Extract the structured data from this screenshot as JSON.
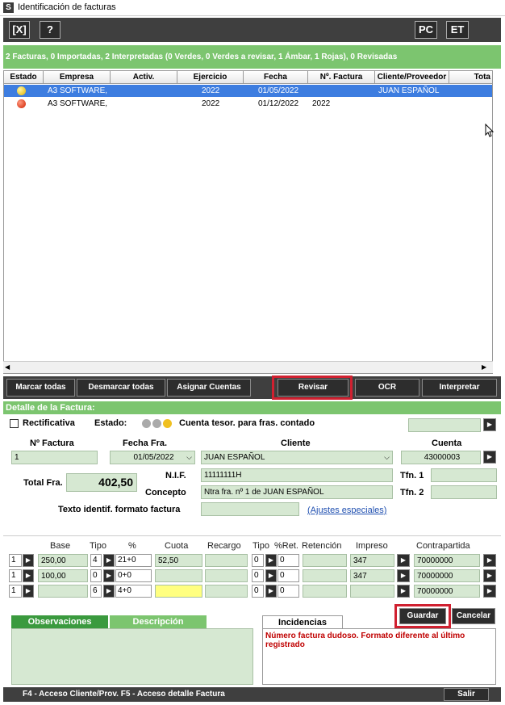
{
  "window": {
    "title": "Identificación de facturas",
    "app_icon": "S"
  },
  "toolbar": {
    "close_label": "[X]",
    "help_label": "?",
    "pc_label": "PC",
    "et_label": "ET"
  },
  "summary": "2 Facturas, 0 Importadas, 2 Interpretadas (0 Verdes, 0 Verdes a revisar, 1 Ámbar, 1 Rojas), 0 Revisadas",
  "grid": {
    "headers": [
      "Estado",
      "Empresa",
      "Activ.",
      "Ejercicio",
      "Fecha",
      "Nº. Factura",
      "Cliente/Proveedor",
      "Tota"
    ],
    "rows": [
      {
        "status": "amber",
        "empresa": "A3 SOFTWARE,",
        "ejercicio": "2022",
        "fecha": "01/05/2022",
        "factura": "",
        "cliente": "JUAN ESPAÑOL"
      },
      {
        "status": "red",
        "empresa": "A3 SOFTWARE,",
        "ejercicio": "2022",
        "fecha": "01/12/2022",
        "factura": "2022",
        "cliente": ""
      }
    ]
  },
  "actions": {
    "marcar": "Marcar todas",
    "desmarcar": "Desmarcar todas",
    "asignar": "Asignar Cuentas",
    "revisar": "Revisar",
    "ocr": "OCR",
    "interpretar": "Interpretar"
  },
  "detail": {
    "title": "Detalle de la Factura:",
    "rectificativa": "Rectificativa",
    "estado_label": "Estado:",
    "cuenta_tesor": "Cuenta tesor. para fras. contado",
    "nfactura_label": "Nº Factura",
    "nfactura": "1",
    "fecha_label": "Fecha Fra.",
    "fecha": "01/05/2022",
    "cliente_label": "Cliente",
    "cliente": "JUAN ESPAÑOL",
    "cuenta_label": "Cuenta",
    "cuenta": "43000003",
    "total_label": "Total Fra.",
    "total": "402,50",
    "nif_label": "N.I.F.",
    "nif": "11111111H",
    "tfn1_label": "Tfn. 1",
    "concepto_label": "Concepto",
    "concepto": "Ntra fra. nº 1 de JUAN ESPAÑOL",
    "tfn2_label": "Tfn. 2",
    "texto_label": "Texto identif. formato factura",
    "ajustes": "(Ajustes especiales)"
  },
  "lines": {
    "headers": [
      "Base",
      "Tipo",
      "%",
      "Cuota",
      "Recargo",
      "Tipo",
      "%Ret.",
      "Retención",
      "Impreso",
      "Contrapartida"
    ],
    "rows": [
      {
        "n": "1",
        "base": "250,00",
        "tipo": "4",
        "pct": "21+0",
        "cuota": "52,50",
        "tipo2": "0",
        "ret": "0",
        "impreso": "347",
        "contra": "70000000"
      },
      {
        "n": "1",
        "base": "100,00",
        "tipo": "0",
        "pct": "0+0",
        "cuota": "",
        "tipo2": "0",
        "ret": "0",
        "impreso": "347",
        "contra": "70000000"
      },
      {
        "n": "1",
        "base": "",
        "tipo": "6",
        "pct": "4+0",
        "cuota": "",
        "tipo2": "0",
        "ret": "0",
        "impreso": "",
        "contra": "70000000"
      }
    ]
  },
  "tabs": {
    "observaciones": "Observaciones",
    "descripcion": "Descripción",
    "incidencias": "Incidencias"
  },
  "incidencia_text": "Número factura dudoso. Formato diferente al último registrado",
  "buttons": {
    "guardar": "Guardar",
    "cancelar": "Cancelar",
    "salir": "Salir"
  },
  "footer": "F4 - Acceso Cliente/Prov.   F5 - Acceso detalle Factura",
  "colors": {
    "green": "#7cc56f",
    "selection": "#3d7de0",
    "highlight": "#d02030"
  }
}
